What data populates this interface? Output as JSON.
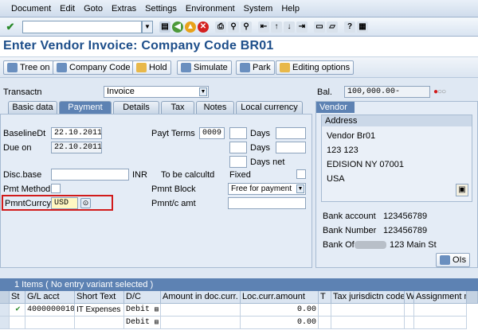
{
  "menu": [
    "Document",
    "Edit",
    "Goto",
    "Extras",
    "Settings",
    "Environment",
    "System",
    "Help"
  ],
  "title": "Enter Vendor Invoice: Company Code BR01",
  "app_toolbar": {
    "tree_on": "Tree on",
    "company_code": "Company Code",
    "hold": "Hold",
    "simulate": "Simulate",
    "park": "Park",
    "editing_options": "Editing options"
  },
  "header": {
    "transactn_label": "Transactn",
    "transactn_value": "Invoice",
    "bal_label": "Bal.",
    "bal_value": "100,000.00-"
  },
  "tabs": [
    "Basic data",
    "Payment",
    "Details",
    "Tax",
    "Notes",
    "Local currency"
  ],
  "active_tab": "Payment",
  "payment": {
    "baselinedt_label": "BaselineDt",
    "baselinedt_value": "22.10.2011",
    "dueon_label": "Due on",
    "dueon_value": "22.10.2011",
    "payt_terms_label": "Payt Terms",
    "payt_terms_value": "0009",
    "days_label": "Days",
    "days_net_label": "Days net",
    "disc_base_label": "Disc.base",
    "inr_label": "INR",
    "to_be_calc_label": "To be calcultd",
    "fixed_label": "Fixed",
    "pmnt_method_label": "Pmt Method",
    "pmnt_block_label": "Pmnt Block",
    "pmnt_block_value": "Free for payment",
    "pmntcurrcy_label": "PmntCurrcy",
    "pmntcurrcy_value": "USD",
    "pmntc_amt_label": "Pmnt/c amt"
  },
  "vendor": {
    "tab_label": "Vendor",
    "address_label": "Address",
    "address_lines": [
      "Vendor Br01",
      "123 123",
      "EDISION NY  07001",
      "USA"
    ],
    "bank_account_label": "Bank account",
    "bank_account_value": "123456789",
    "bank_number_label": "Bank Number",
    "bank_number_value": "123456789",
    "bank_of_label": "Bank Of",
    "bank_of_value": "123 Main St",
    "ois_label": "OIs"
  },
  "items": {
    "header": "1 Items ( No entry variant selected )",
    "columns": [
      "St",
      "G/L acct",
      "Short Text",
      "D/C",
      "Amount in doc.curr.",
      "Loc.curr.amount",
      "T",
      "Tax jurisdictn code",
      "W",
      "Assignment n"
    ],
    "rows": [
      {
        "status": "✔",
        "gl_acct": "4000000010",
        "short_text": "IT Expenses",
        "dc": "Debit",
        "amount_doc": "",
        "amount_loc": "0.00"
      },
      {
        "status": "",
        "gl_acct": "",
        "short_text": "",
        "dc": "Debit",
        "amount_doc": "",
        "amount_loc": "0.00"
      }
    ]
  },
  "colors": {
    "title": "#1d4e8a",
    "active_tab": "#5d82b3",
    "highlight_box": "#d11b1b"
  }
}
